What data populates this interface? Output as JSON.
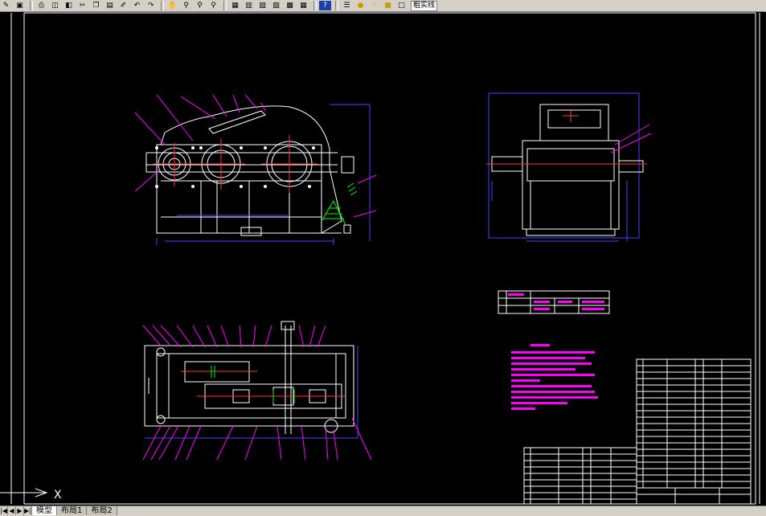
{
  "toolbar": {
    "icons": [
      "draw-icon",
      "save-icon",
      "print-icon",
      "preview-icon",
      "publish-icon",
      "cut-icon",
      "copy-icon",
      "paste-icon",
      "match-icon",
      "undo-icon",
      "redo-icon",
      "pan-icon",
      "zoom-realtime-icon",
      "zoom-window-icon",
      "zoom-previous-icon",
      "properties-icon",
      "design-center-icon",
      "tool-palette-icon",
      "sheet-set-icon",
      "markup-icon",
      "calculator-icon",
      "help-icon",
      "layer-icon",
      "lightbulb-icon",
      "sun-icon",
      "lock-icon",
      "color-square-icon"
    ],
    "current_layer": "粗实线"
  },
  "ucs": {
    "x_label": "X"
  },
  "tabs": [
    {
      "label": "模型",
      "active": true
    },
    {
      "label": "布局1",
      "active": false
    },
    {
      "label": "布局2",
      "active": false
    }
  ],
  "drawing": {
    "colors": {
      "geometry": "#ffffff",
      "dimension": "#4444ff",
      "leader": "#ff00ff",
      "center": "#ff3333",
      "hatch": "#00ff00",
      "note": "#ff00ff",
      "background": "#000000"
    }
  }
}
